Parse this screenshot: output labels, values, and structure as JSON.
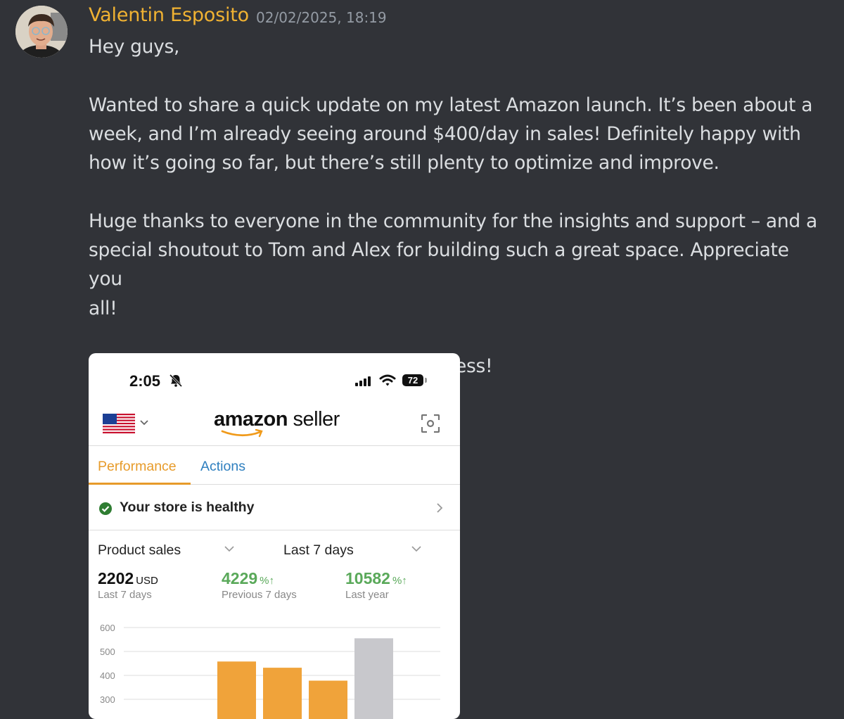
{
  "message": {
    "author": "Valentin Esposito",
    "timestamp": "02/02/2025, 18:19",
    "lines": [
      "Hey guys,",
      "",
      "Wanted to share a quick update on my latest Amazon launch. It’s been about a",
      "week, and I’m already seeing around $400/day in sales! Definitely happy with",
      "how it’s going so far, but there’s still plenty to optimize and improve.",
      "",
      "Huge thanks to everyone in the community for the insights and support – and a",
      "special shoutout to Tom and Alex for building such a great space. Appreciate you",
      "all!",
      "",
      "I’ll keep you posted on how things progress!"
    ]
  },
  "phone": {
    "time": "2:05",
    "battery": "72",
    "brand_bold": "amazon",
    "brand_light": " seller",
    "tabs": [
      "Performance",
      "Actions"
    ],
    "health": "Your store is healthy",
    "metric": "Product sales",
    "period": "Last 7 days",
    "stats": [
      {
        "value": "2202",
        "unit": "USD",
        "label": "Last 7 days"
      },
      {
        "value": "4229",
        "unit": "%↑",
        "label": "Previous 7 days"
      },
      {
        "value": "10582",
        "unit": "%↑",
        "label": "Last year"
      }
    ]
  },
  "chart_data": {
    "type": "bar",
    "yticks": [
      300,
      400,
      500,
      600
    ],
    "ylim": [
      300,
      600
    ],
    "values": [
      458,
      432,
      378,
      555
    ],
    "colors": [
      "#f0a33a",
      "#f0a33a",
      "#f0a33a",
      "#c8c8cc"
    ]
  }
}
